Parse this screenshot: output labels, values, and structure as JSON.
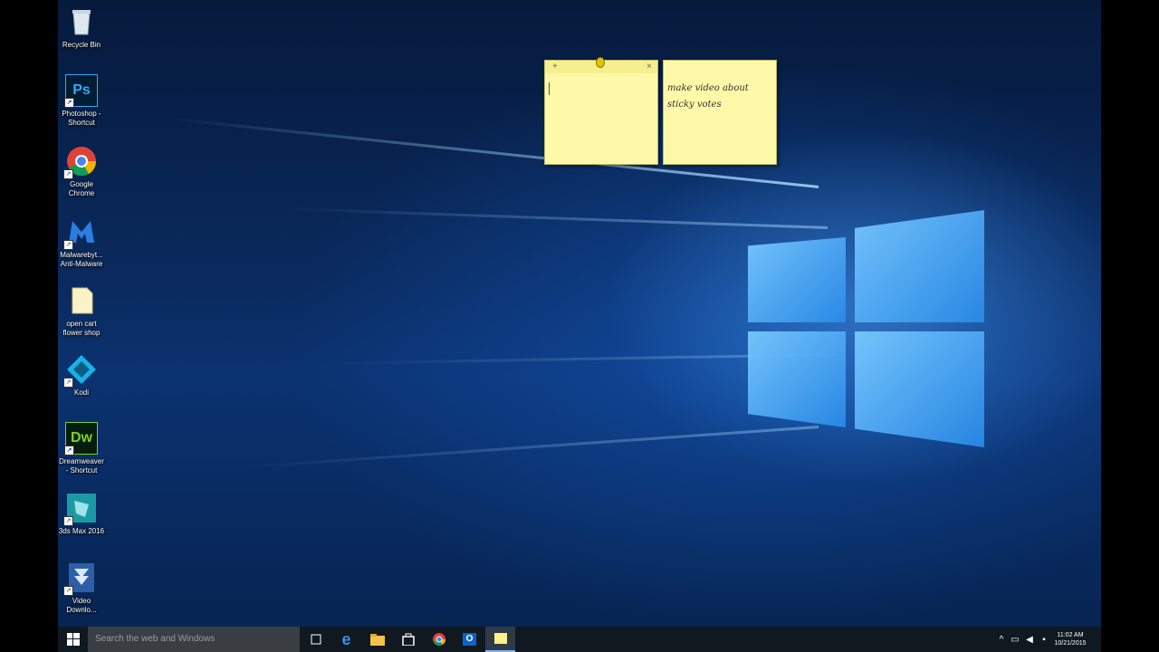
{
  "desktop_icons": [
    {
      "label": "Recycle Bin",
      "icon": "recycle-bin-icon"
    },
    {
      "label": "Photoshop - Shortcut",
      "icon": "photoshop-icon",
      "glyph": "Ps"
    },
    {
      "label": "Google Chrome",
      "icon": "chrome-icon"
    },
    {
      "label": "Malwarebyt... Anti-Malware",
      "icon": "malwarebytes-icon"
    },
    {
      "label": "open cart flower shop",
      "icon": "folder-icon"
    },
    {
      "label": "Kodi",
      "icon": "kodi-icon"
    },
    {
      "label": "Dreamweaver - Shortcut",
      "icon": "dreamweaver-icon",
      "glyph": "Dw"
    },
    {
      "label": "3ds Max 2016",
      "icon": "3dsmax-icon"
    },
    {
      "label": "Video Downlo...",
      "icon": "video-downloader-icon"
    }
  ],
  "sticky_notes": [
    {
      "text": "",
      "add": "+",
      "close": "×"
    },
    {
      "text": "make video about sticky votes"
    }
  ],
  "taskbar": {
    "search_placeholder": "Search the web and Windows",
    "time": "11:02 AM",
    "date": "10/21/2015"
  },
  "colors": {
    "note": "#fdf9a8",
    "taskbar": "#101820",
    "accent": "#3b8fe6"
  }
}
